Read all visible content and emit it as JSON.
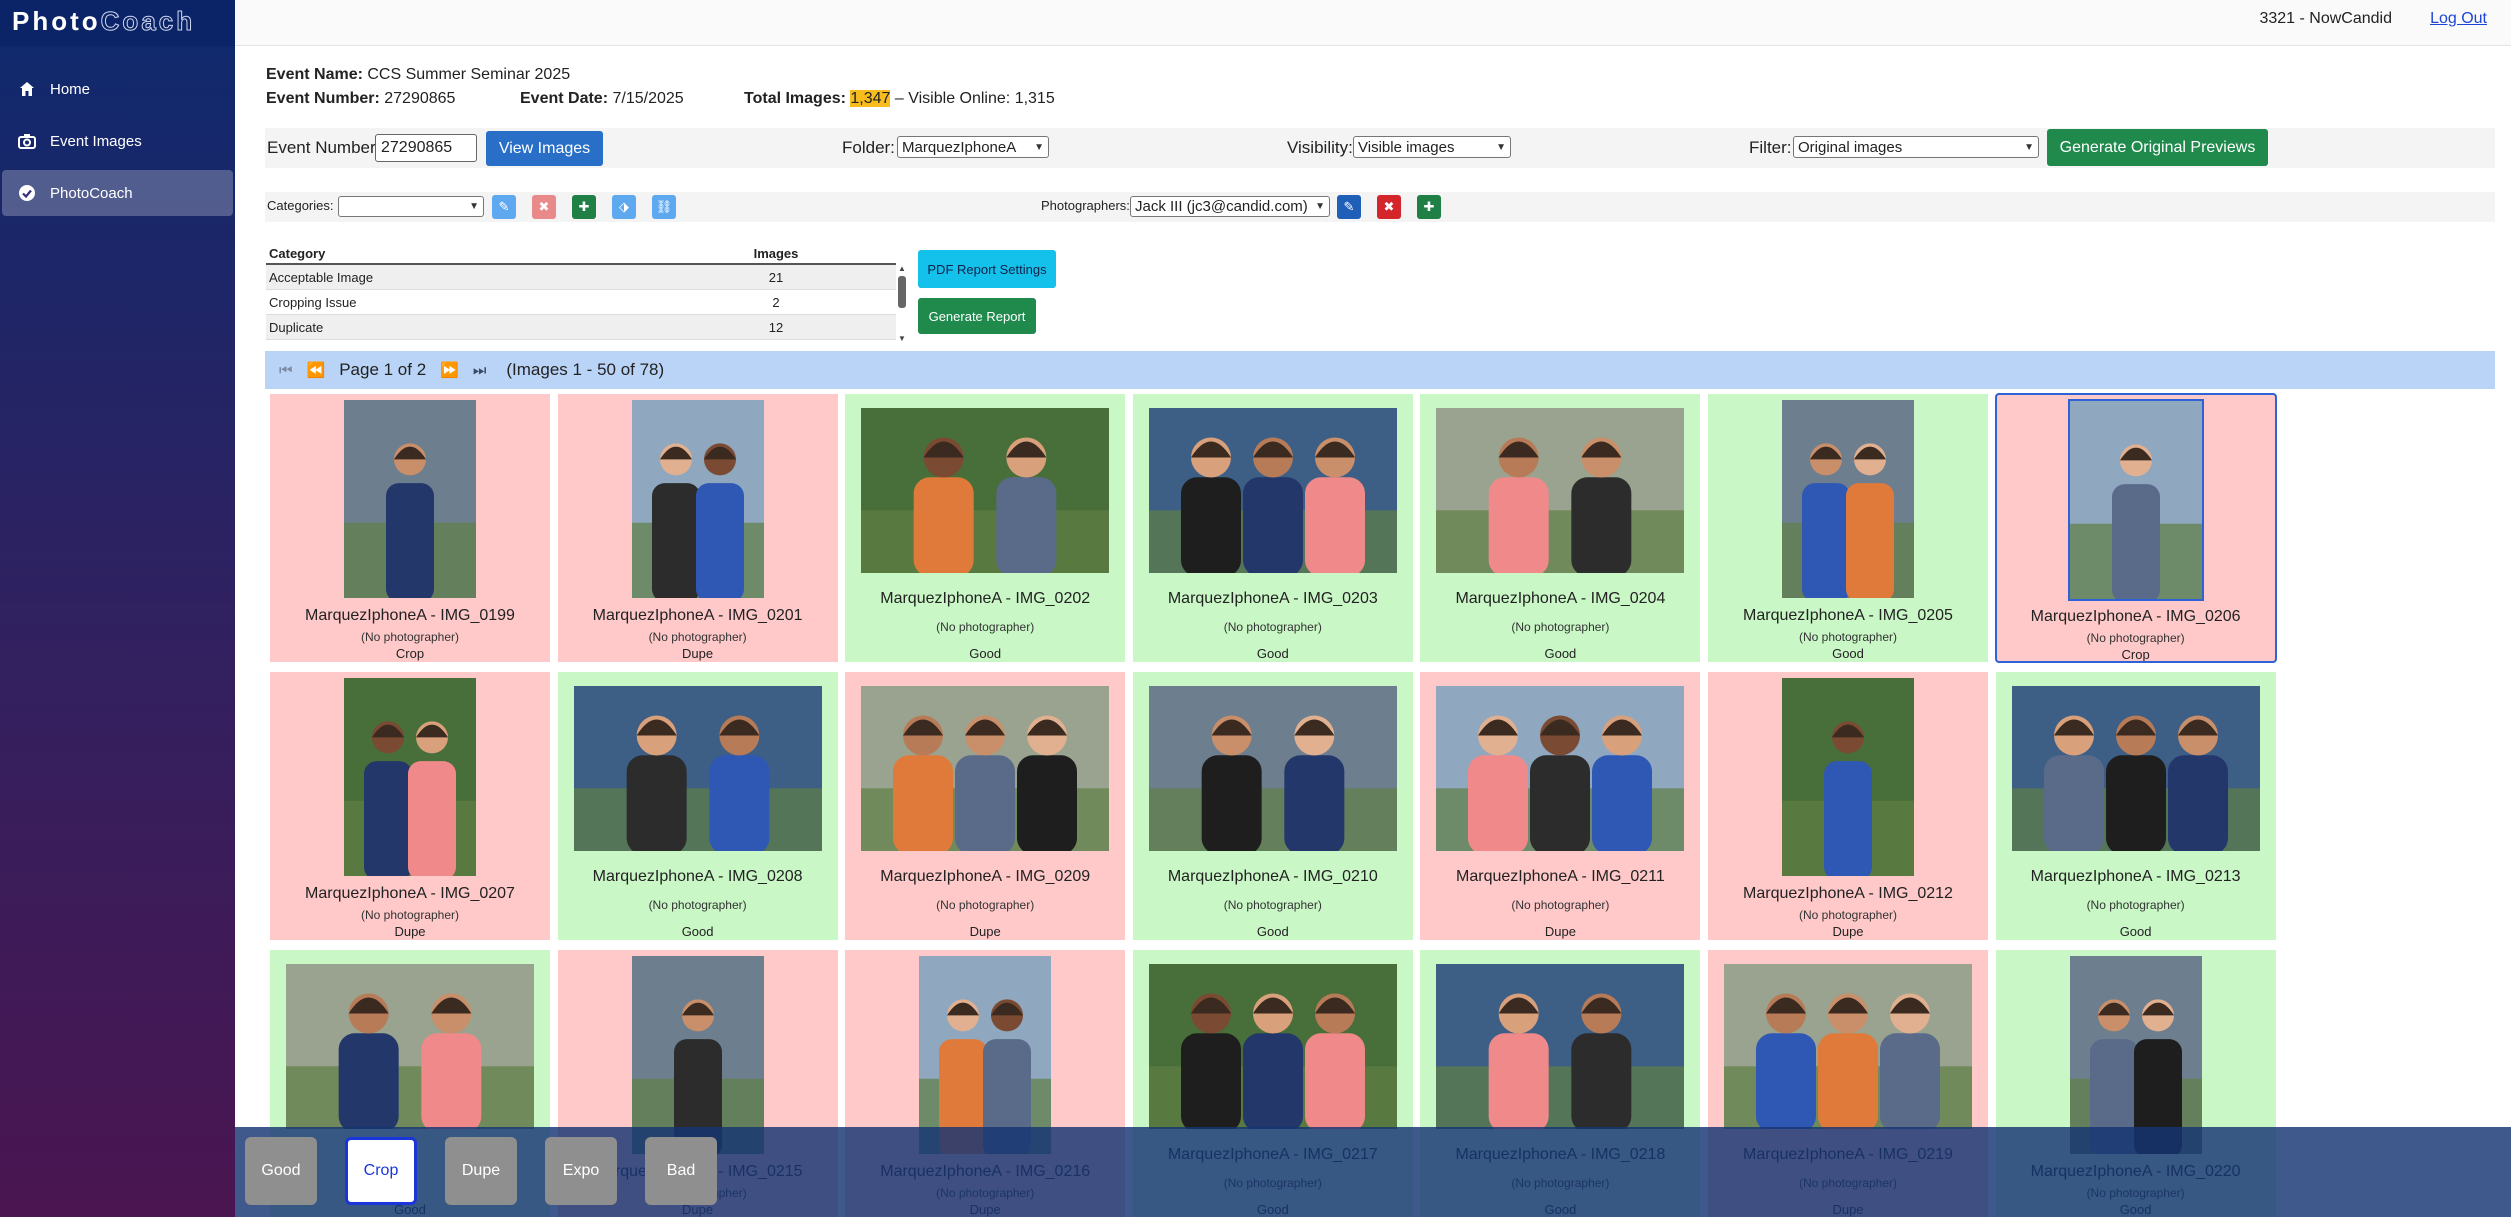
{
  "app": {
    "logo_a": "Photo",
    "logo_b": "Coach"
  },
  "nav": [
    {
      "label": "Home",
      "icon": "home-icon"
    },
    {
      "label": "Event Images",
      "icon": "camera-icon"
    },
    {
      "label": "PhotoCoach",
      "icon": "check-circle-icon"
    }
  ],
  "account": {
    "name": "3321 - NowCandid",
    "logout": "Log Out"
  },
  "event": {
    "name_label": "Event Name:",
    "name": "CCS Summer Seminar 2025",
    "number_label": "Event Number:",
    "number": "27290865",
    "date_label": "Event Date:",
    "date": "7/15/2025",
    "total_label": "Total Images:",
    "total": "1,347",
    "visible_sep": " – Visible Online:",
    "visible": "1,315"
  },
  "controls": {
    "event_number_label": "Event Number:",
    "event_number_value": "27290865",
    "view_images": "View Images",
    "folder_label": "Folder:",
    "folder_value": "MarquezIphoneA",
    "visibility_label": "Visibility:",
    "visibility_value": "Visible images",
    "filter_label": "Filter:",
    "filter_value": "Original images",
    "generate_previews": "Generate Original Previews"
  },
  "categories_row": {
    "label": "Categories:",
    "value": "",
    "photographers_label": "Photographers:",
    "photographers_value": "Jack III (jc3@candid.com)"
  },
  "cat_table": {
    "headers": [
      "Category",
      "Images"
    ],
    "rows": [
      {
        "category": "Acceptable Image",
        "images": "21"
      },
      {
        "category": "Cropping Issue",
        "images": "2"
      },
      {
        "category": "Duplicate",
        "images": "12"
      }
    ]
  },
  "report": {
    "settings": "PDF Report Settings",
    "generate": "Generate Report"
  },
  "pager": {
    "page": "Page 1 of 2",
    "range": "(Images 1 - 50 of 78)"
  },
  "colors": {
    "good": "#c9f7c6",
    "bad": "#ffc9c9",
    "accent": "#2f62d6"
  },
  "images": [
    {
      "name": "MarquezIphoneA - IMG_0199",
      "photographer": "(No photographer)",
      "status": "Crop",
      "orient": "port"
    },
    {
      "name": "MarquezIphoneA - IMG_0201",
      "photographer": "(No photographer)",
      "status": "Dupe",
      "orient": "port"
    },
    {
      "name": "MarquezIphoneA - IMG_0202",
      "photographer": "(No photographer)",
      "status": "Good",
      "orient": "land"
    },
    {
      "name": "MarquezIphoneA - IMG_0203",
      "photographer": "(No photographer)",
      "status": "Good",
      "orient": "land"
    },
    {
      "name": "MarquezIphoneA - IMG_0204",
      "photographer": "(No photographer)",
      "status": "Good",
      "orient": "land"
    },
    {
      "name": "MarquezIphoneA - IMG_0205",
      "photographer": "(No photographer)",
      "status": "Good",
      "orient": "port"
    },
    {
      "name": "MarquezIphoneA - IMG_0206",
      "photographer": "(No photographer)",
      "status": "Crop",
      "orient": "port",
      "selected": true
    },
    {
      "name": "MarquezIphoneA - IMG_0207",
      "photographer": "(No photographer)",
      "status": "Dupe",
      "orient": "port"
    },
    {
      "name": "MarquezIphoneA - IMG_0208",
      "photographer": "(No photographer)",
      "status": "Good",
      "orient": "land"
    },
    {
      "name": "MarquezIphoneA - IMG_0209",
      "photographer": "(No photographer)",
      "status": "Dupe",
      "orient": "land"
    },
    {
      "name": "MarquezIphoneA - IMG_0210",
      "photographer": "(No photographer)",
      "status": "Good",
      "orient": "land"
    },
    {
      "name": "MarquezIphoneA - IMG_0211",
      "photographer": "(No photographer)",
      "status": "Dupe",
      "orient": "land"
    },
    {
      "name": "MarquezIphoneA - IMG_0212",
      "photographer": "(No photographer)",
      "status": "Dupe",
      "orient": "port"
    },
    {
      "name": "MarquezIphoneA - IMG_0213",
      "photographer": "(No photographer)",
      "status": "Good",
      "orient": "land"
    },
    {
      "name": "",
      "photographer": "",
      "status": "Good",
      "orient": "land"
    },
    {
      "name": "MarquezIphoneA - IMG_0215",
      "photographer": "(No photographer)",
      "status": "Dupe",
      "orient": "port"
    },
    {
      "name": "MarquezIphoneA - IMG_0216",
      "photographer": "(No photographer)",
      "status": "Dupe",
      "orient": "port"
    },
    {
      "name": "MarquezIphoneA - IMG_0217",
      "photographer": "(No photographer)",
      "status": "Good",
      "orient": "land"
    },
    {
      "name": "MarquezIphoneA - IMG_0218",
      "photographer": "(No photographer)",
      "status": "Good",
      "orient": "land"
    },
    {
      "name": "MarquezIphoneA - IMG_0219",
      "photographer": "(No photographer)",
      "status": "Dupe",
      "orient": "land"
    },
    {
      "name": "MarquezIphoneA - IMG_0220",
      "photographer": "(No photographer)",
      "status": "Good",
      "orient": "port"
    }
  ],
  "classify_buttons": [
    {
      "label": "Good",
      "active": false
    },
    {
      "label": "Crop",
      "active": true
    },
    {
      "label": "Dupe",
      "active": false
    },
    {
      "label": "Expo",
      "active": false
    },
    {
      "label": "Bad",
      "active": false
    }
  ]
}
